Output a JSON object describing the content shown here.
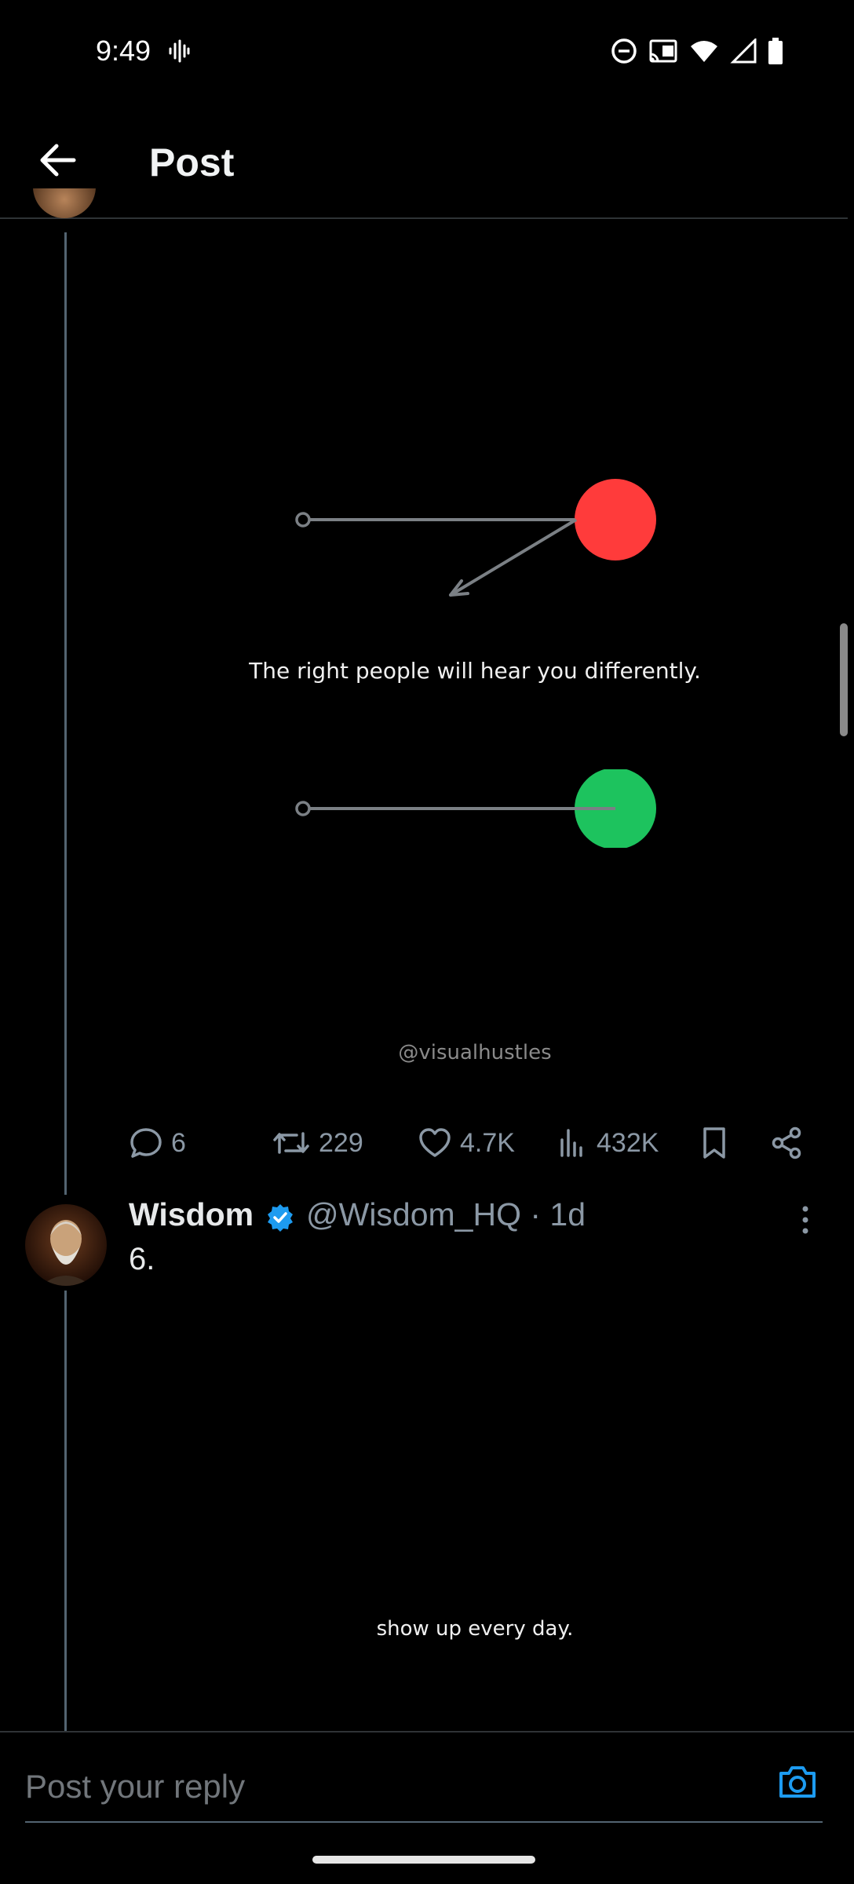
{
  "status_bar": {
    "time": "9:49"
  },
  "header": {
    "title": "Post"
  },
  "media1": {
    "caption": "The right people will hear you differently.",
    "watermark": "@visualhustles",
    "colors": {
      "red_dot": "#ff3b3b",
      "green_dot": "#1dc35e",
      "line": "#7b8085"
    }
  },
  "actions": {
    "replies": "6",
    "reposts": "229",
    "likes": "4.7K",
    "views": "432K"
  },
  "reply_post": {
    "author_name": "Wisdom",
    "handle_time": "@Wisdom_HQ · 1d",
    "text": "6.",
    "media_caption": "show up every day."
  },
  "reply_bar": {
    "placeholder": "Post your reply"
  },
  "accent_color": "#1d9bf0"
}
